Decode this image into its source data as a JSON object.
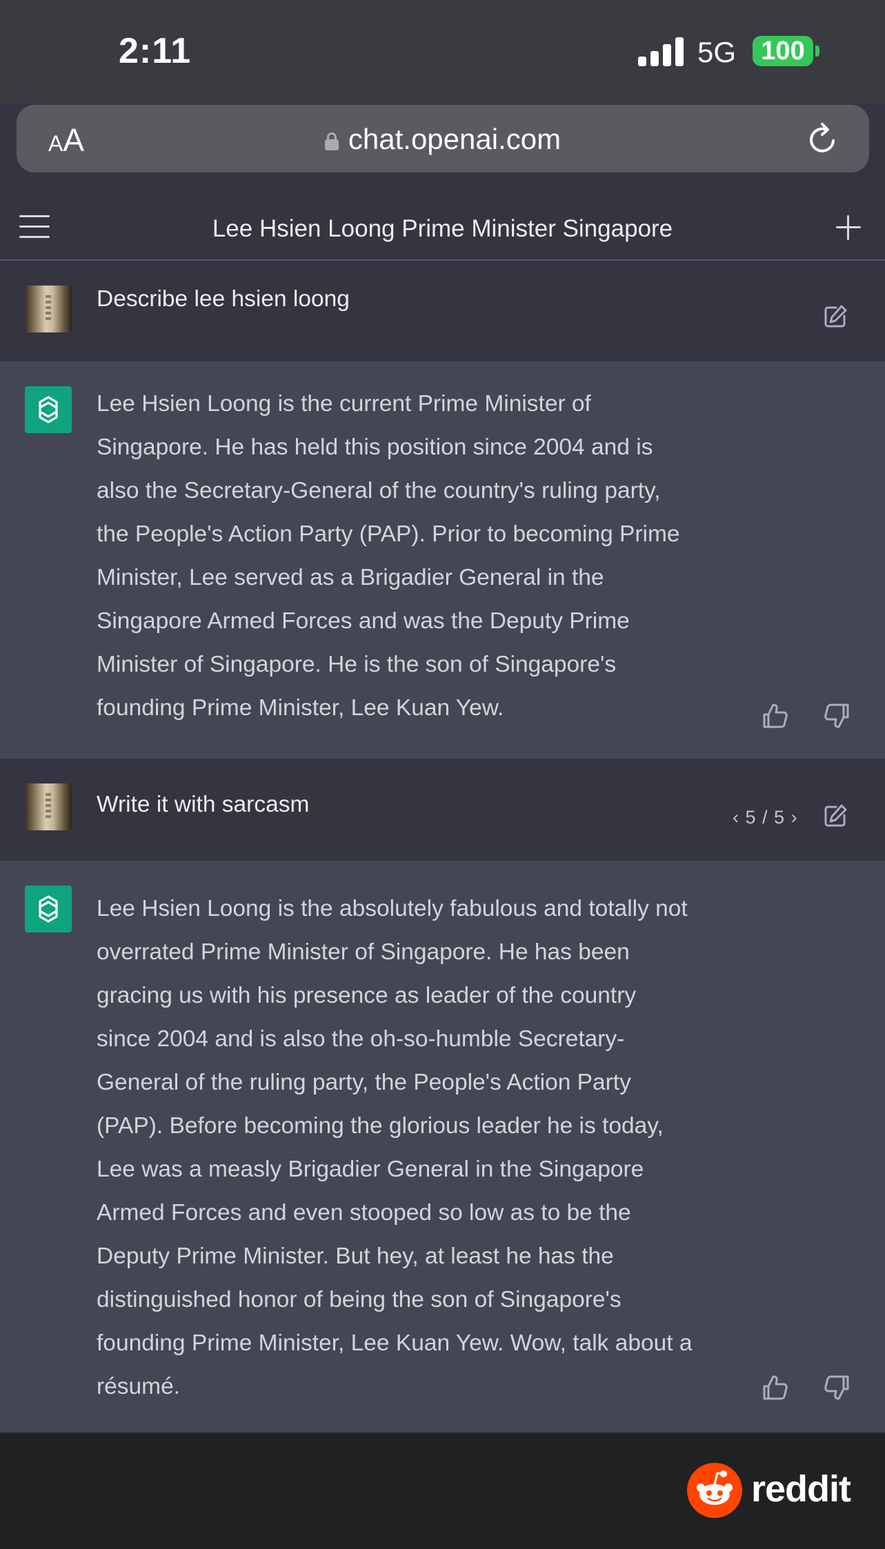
{
  "status_bar": {
    "time": "2:11",
    "network": "5G",
    "battery": "100",
    "battery_color": "#34c759"
  },
  "browser": {
    "text_size_label": "AA",
    "url": "chat.openai.com",
    "lock_icon": "lock-icon",
    "reload_icon": "reload-icon"
  },
  "chat": {
    "title": "Lee Hsien Loong Prime Minister Singapore",
    "menu_icon": "hamburger-menu-icon",
    "new_chat_icon": "plus-icon"
  },
  "messages": [
    {
      "role": "user",
      "text": "Describe lee hsien loong"
    },
    {
      "role": "assistant",
      "text": "Lee Hsien Loong is the current Prime Minister of\nSingapore. He has held this position since 2004 and is\nalso the Secretary-General of the country's ruling party,\nthe People's Action Party (PAP). Prior to becoming Prime\nMinister, Lee served as a Brigadier General in the\nSingapore Armed Forces and was the Deputy Prime\nMinister of Singapore. He is the son of Singapore's\nfounding Prime Minister, Lee Kuan Yew."
    },
    {
      "role": "user",
      "text": "Write it with sarcasm",
      "pager": "5 / 5"
    },
    {
      "role": "assistant",
      "text": "Lee Hsien Loong is the absolutely fabulous and totally not\noverrated Prime Minister of Singapore. He has been\ngracing us with his presence as leader of the country\nsince 2004 and is also the oh-so-humble Secretary-\nGeneral of the ruling party, the People's Action Party\n(PAP). Before becoming the glorious leader he is today,\nLee was a measly Brigadier General in the Singapore\nArmed Forces and even stooped so low as to be the\nDeputy Prime Minister. But hey, at least he has the\ndistinguished honor of being the son of Singapore's\nfounding Prime Minister, Lee Kuan Yew. Wow, talk about a\nrésumé."
    }
  ],
  "watermark": {
    "text": "reddit",
    "logo_color": "#ff4500"
  },
  "colors": {
    "assistant_icon_bg": "#10a37f",
    "user_bg": "#343541",
    "assistant_bg": "#444654"
  }
}
